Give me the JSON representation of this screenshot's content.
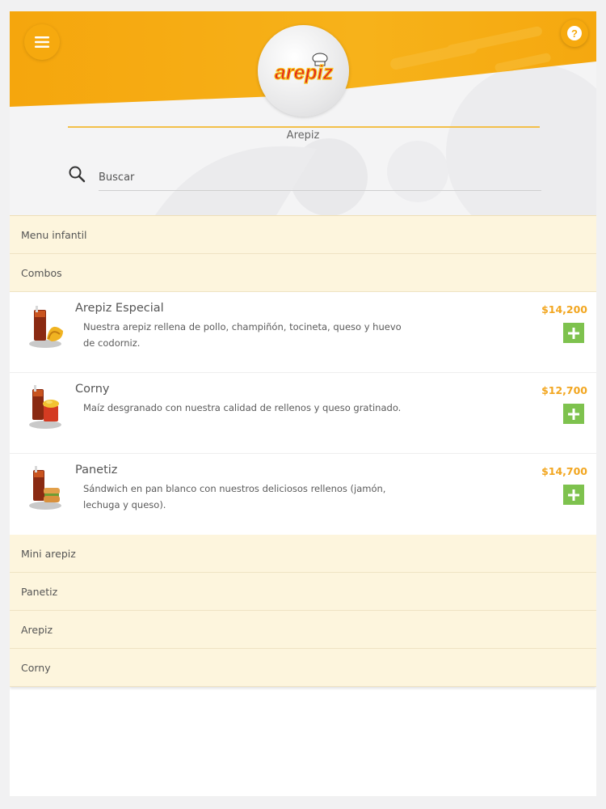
{
  "colors": {
    "accent": "#f6a90e",
    "category_bg": "#fdf5dd",
    "price": "#f2a620",
    "add_button": "#7ec24e"
  },
  "header": {
    "menu_icon": "hamburger-menu-icon",
    "help_icon": "question-mark-icon",
    "logo_text": "arepiz",
    "restaurant_name": "Arepiz"
  },
  "search": {
    "icon": "search-icon",
    "placeholder": "Buscar",
    "value": ""
  },
  "categories_top": [
    {
      "label": "Menu infantil"
    },
    {
      "label": "Combos"
    }
  ],
  "products": [
    {
      "name": "Arepiz Especial",
      "description": "Nuestra arepiz rellena de pollo, champiñón, tocineta, queso y huevo de codorniz.",
      "price": "$14,200",
      "add_icon": "plus-icon"
    },
    {
      "name": "Corny",
      "description": "Maíz desgranado con nuestra calidad de rellenos y queso gratinado.",
      "price": "$12,700",
      "add_icon": "plus-icon"
    },
    {
      "name": "Panetiz",
      "description": "Sándwich en pan blanco con nuestros deliciosos rellenos (jamón, lechuga y queso).",
      "price": "$14,700",
      "add_icon": "plus-icon"
    }
  ],
  "categories_bottom": [
    {
      "label": "Mini arepiz"
    },
    {
      "label": "Panetiz"
    },
    {
      "label": "Arepiz"
    },
    {
      "label": "Corny"
    }
  ]
}
